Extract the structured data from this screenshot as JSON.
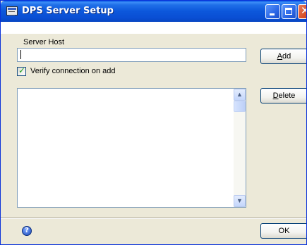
{
  "window": {
    "title": "DPS Server Setup",
    "title_icon": "window-icon",
    "controls": {
      "minimize": "minimize-icon",
      "maximize": "maximize-icon",
      "close": "✕"
    }
  },
  "form": {
    "server_host_label": "Server Host",
    "server_host_value": "",
    "verify_checkbox": {
      "label": "Verify connection on add",
      "checked": true,
      "check_glyph": "✓"
    },
    "add_button": {
      "accel": "A",
      "rest": "dd"
    },
    "delete_button": {
      "accel": "D",
      "rest": "elete"
    },
    "servers_list": []
  },
  "scrollbar": {
    "up_glyph": "▲",
    "down_glyph": "▼"
  },
  "footer": {
    "help_glyph": "?",
    "ok_button": "OK"
  },
  "colors": {
    "title_bar": "#0a4fd4",
    "dialog_background": "#ece9d8",
    "input_border": "#7f9db9",
    "close_button": "#d9512b"
  }
}
